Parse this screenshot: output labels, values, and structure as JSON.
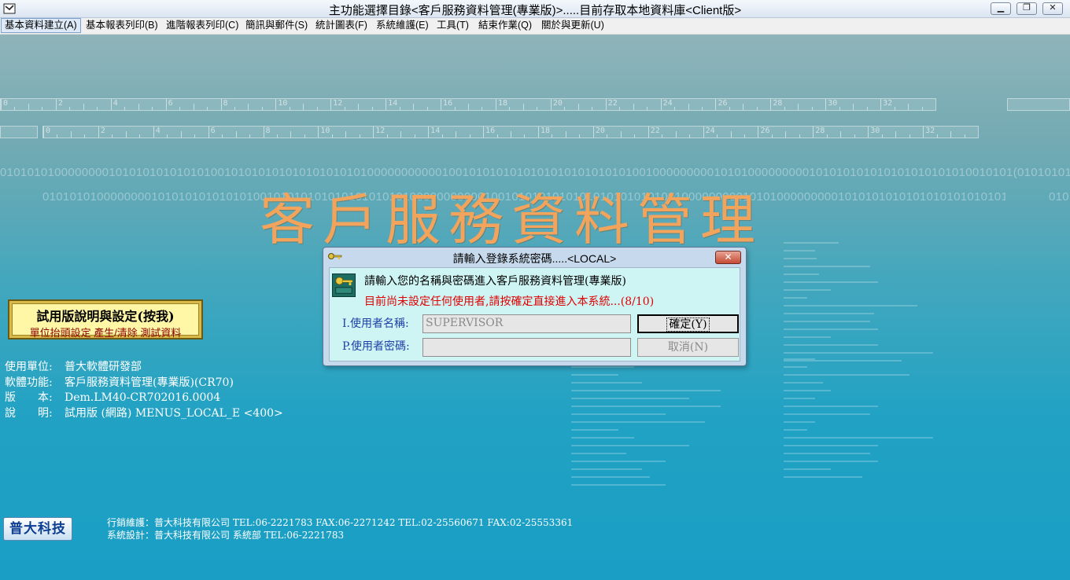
{
  "window": {
    "title": "主功能選擇目錄<客戶服務資料管理(專業版)>.....目前存取本地資料庫<Client版>",
    "controls": [
      "minimize-icon",
      "maximize-icon",
      "close-icon"
    ]
  },
  "menu": [
    {
      "label": "基本資料建立(A)"
    },
    {
      "label": "基本報表列印(B)"
    },
    {
      "label": "進階報表列印(C)"
    },
    {
      "label": "簡訊與郵件(S)"
    },
    {
      "label": "統計圖表(F)"
    },
    {
      "label": "系統維護(E)"
    },
    {
      "label": "工具(T)"
    },
    {
      "label": "結束作業(Q)"
    },
    {
      "label": "關於與更新(U)"
    }
  ],
  "background": {
    "ruler1_numbers": [
      "0",
      "2",
      "4",
      "6",
      "8",
      "10",
      "12",
      "14",
      "16",
      "18",
      "20",
      "22",
      "24",
      "26",
      "28",
      "30",
      "32"
    ],
    "ruler2_numbers": [
      "0",
      "2",
      "4",
      "6",
      "8",
      "10",
      "12",
      "14",
      "16",
      "18",
      "20",
      "22",
      "24",
      "26",
      "28",
      "30",
      "32"
    ],
    "binary_line_1": "01010101000000001010101010101010010101010101010101010100000000000100101010101010101010101010100100000000010101000000000101010101010101010101010010101(0101010101",
    "binary_line_2": "010101010000000010101010101010100101010101010101010101000000000001001010101010101010101010100100000000010101000000000101010101010101010101010100",
    "big_title": "客戶服務資料管理"
  },
  "trial_button": {
    "title": "試用版說明與設定(按我)",
    "subtitle": "單位抬頭設定 產生/清除 測試資料"
  },
  "info": {
    "unit_label": "使用單位:",
    "unit_value": "普大軟體研發部",
    "func_label": "軟體功能:",
    "func_value": "客戶服務資料管理(專業版)(CR70)",
    "ver_label": "版　　本:",
    "ver_value": "Dem.LM40-CR702016.0004",
    "desc_label": "說　　明:",
    "desc_value": "試用版 (網路) MENUS_LOCAL_E <400>"
  },
  "logo": "普大科技",
  "footer": {
    "line1": "行銷維護：普大科技有限公司 TEL:06-2221783  FAX:06-2271242 TEL:02-25560671 FAX:02-25553361",
    "line2": "系統設計：普大科技有限公司 系統部 TEL:06-2221783"
  },
  "dialog": {
    "title": "請輸入登錄系統密碼.....<LOCAL>",
    "message": "請輸入您的名稱與密碼進入客戶服務資料管理(專業版)",
    "warning": "目前尚未設定任何使用者,請按確定直接進入本系統...(8/10)",
    "user_label": "I.使用者名稱:",
    "user_value": "SUPERVISOR",
    "pass_label": "P.使用者密碼:",
    "pass_value": "",
    "ok_label": "確定(Y)",
    "cancel_label": "取消(N)",
    "close_symbol": "✕"
  }
}
